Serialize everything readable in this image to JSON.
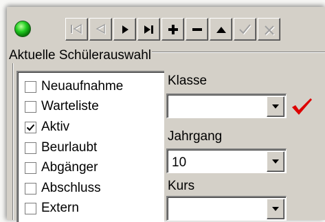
{
  "toolbar": {
    "status_light": {
      "icon": "green-status-light-icon",
      "color": "#22cc22"
    },
    "buttons": [
      {
        "name": "first-record-button",
        "icon": "first-record-icon",
        "enabled": false
      },
      {
        "name": "previous-record-button",
        "icon": "previous-record-icon",
        "enabled": false
      },
      {
        "name": "next-record-button",
        "icon": "next-record-icon",
        "enabled": true
      },
      {
        "name": "last-record-button",
        "icon": "last-record-icon",
        "enabled": true
      },
      {
        "name": "add-record-button",
        "icon": "plus-icon",
        "enabled": true
      },
      {
        "name": "delete-record-button",
        "icon": "minus-icon",
        "enabled": true
      },
      {
        "name": "up-button",
        "icon": "triangle-up-icon",
        "enabled": true
      },
      {
        "name": "confirm-button",
        "icon": "checkmark-icon",
        "enabled": false
      },
      {
        "name": "cancel-button",
        "icon": "cross-icon",
        "enabled": false
      }
    ]
  },
  "selection_group": {
    "title": "Aktuelle Schülerauswahl",
    "status_items": [
      {
        "label": "Neuaufnahme",
        "checked": false
      },
      {
        "label": "Warteliste",
        "checked": false
      },
      {
        "label": "Aktiv",
        "checked": true
      },
      {
        "label": "Beurlaubt",
        "checked": false
      },
      {
        "label": "Abgänger",
        "checked": false
      },
      {
        "label": "Abschluss",
        "checked": false
      },
      {
        "label": "Extern",
        "checked": false
      }
    ],
    "klasse": {
      "label": "Klasse",
      "value": "",
      "confirmed": true,
      "confirm_color": "#dd0000"
    },
    "jahrgang": {
      "label": "Jahrgang",
      "value": "10"
    },
    "kurs": {
      "label": "Kurs",
      "value": ""
    }
  }
}
